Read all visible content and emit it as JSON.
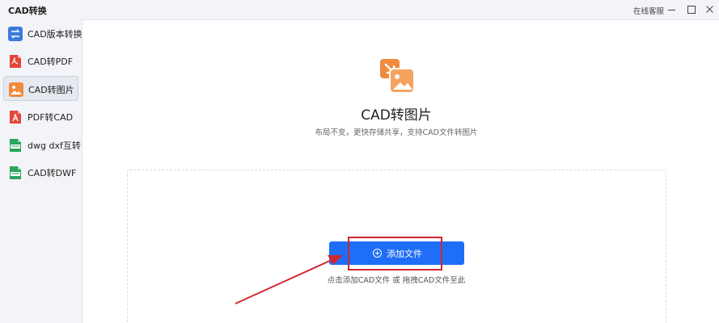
{
  "app": {
    "title": "CAD转换",
    "service_label": "在线客服"
  },
  "sidebar": {
    "items": [
      {
        "label": "CAD版本转换",
        "icon": "version-convert-icon",
        "color": "#3a7bdc",
        "active": false
      },
      {
        "label": "CAD转PDF",
        "icon": "pdf-file-icon",
        "color": "#e2473b",
        "active": false
      },
      {
        "label": "CAD转图片",
        "icon": "image-file-icon",
        "color": "#f08a3c",
        "active": true
      },
      {
        "label": "PDF转CAD",
        "icon": "pdf-to-cad-icon",
        "color": "#e2473b",
        "active": false
      },
      {
        "label": "dwg dxf互转",
        "icon": "dwg-file-icon",
        "color": "#2aa55a",
        "active": false
      },
      {
        "label": "CAD转DWF",
        "icon": "dwf-file-icon",
        "color": "#2aa55a",
        "active": false
      }
    ]
  },
  "main": {
    "title": "CAD转图片",
    "subtitle": "布局不变，更快存储共享，支持CAD文件转图片",
    "add_button_label": "添加文件",
    "hint": "点击添加CAD文件 或 拖拽CAD文件至此"
  },
  "colors": {
    "accent": "#1f6ef7",
    "annotation": "#d0272e",
    "hero": "#f08a3c"
  }
}
